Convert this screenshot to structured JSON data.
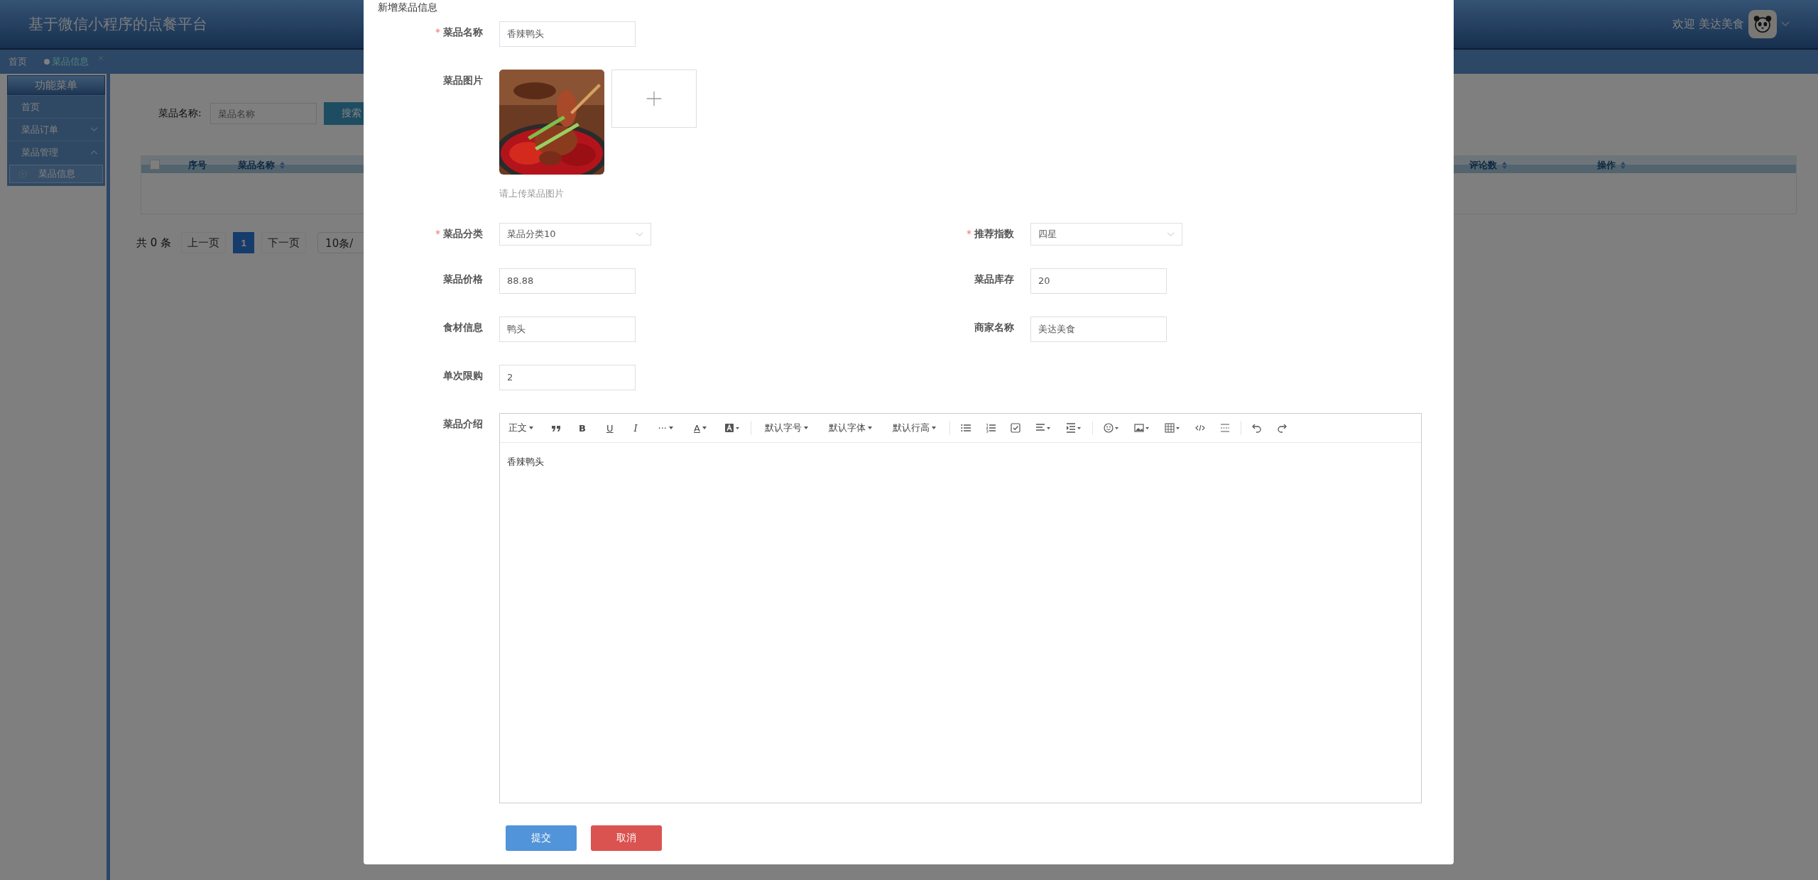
{
  "header": {
    "title": "基于微信小程序的点餐平台",
    "welcome": "欢迎 美达美食"
  },
  "tabs": [
    {
      "label": "首页",
      "selected": false,
      "closable": false
    },
    {
      "label": "菜品信息",
      "selected": true,
      "closable": true
    }
  ],
  "sidebar": {
    "title": "功能菜单",
    "items": [
      {
        "label": "首页",
        "kind": "link"
      },
      {
        "label": "菜品订单",
        "kind": "group",
        "expanded": false
      },
      {
        "label": "菜品管理",
        "kind": "group",
        "expanded": true,
        "children": [
          {
            "label": "菜品信息",
            "selected": true
          }
        ]
      }
    ]
  },
  "search": {
    "label": "菜品名称:",
    "placeholder": "菜品名称",
    "button": "搜索"
  },
  "table": {
    "select_all": {
      "checked": false
    },
    "columns": [
      {
        "label": "序号",
        "sortable": false
      },
      {
        "label": "菜品名称",
        "sortable": true
      },
      {
        "label": "评论数",
        "sortable": true
      },
      {
        "label": "操作",
        "sortable": true
      }
    ]
  },
  "pagination": {
    "total": "共 0 条",
    "prev": "上一页",
    "pages": [
      {
        "label": "1",
        "selected": true
      }
    ],
    "next": "下一页",
    "page_size": "10条/"
  },
  "modal": {
    "title": "新增菜品信息",
    "rows": [
      [
        {
          "kind": "input",
          "label": "菜品名称",
          "required_mark": "*",
          "value": "香辣鸭头"
        }
      ],
      [
        {
          "kind": "upload",
          "label": "菜品图片",
          "hint": "请上传菜品图片"
        }
      ],
      [
        {
          "kind": "select",
          "label": "菜品分类",
          "required_mark": "*",
          "value": "菜品分类10"
        },
        {
          "kind": "select",
          "label": "推荐指数",
          "required_mark": "*",
          "value": "四星"
        }
      ],
      [
        {
          "kind": "input",
          "label": "菜品价格",
          "value": "88.88"
        },
        {
          "kind": "input",
          "label": "菜品库存",
          "value": "20"
        }
      ],
      [
        {
          "kind": "input",
          "label": "食材信息",
          "value": "鸭头"
        },
        {
          "kind": "input",
          "label": "商家名称",
          "value": "美达美食"
        }
      ],
      [
        {
          "kind": "input",
          "label": "单次限购",
          "value": "2"
        }
      ],
      [
        {
          "kind": "editor",
          "label": "菜品介绍",
          "toolbar": [
            "正文",
            "B",
            "U",
            "I",
            "···",
            "A",
            "默认字号",
            "默认字体",
            "默认行高"
          ],
          "content": "香辣鸭头"
        }
      ]
    ],
    "buttons": [
      {
        "label": "提交",
        "kind": "primary"
      },
      {
        "label": "取消",
        "kind": "danger"
      }
    ]
  }
}
